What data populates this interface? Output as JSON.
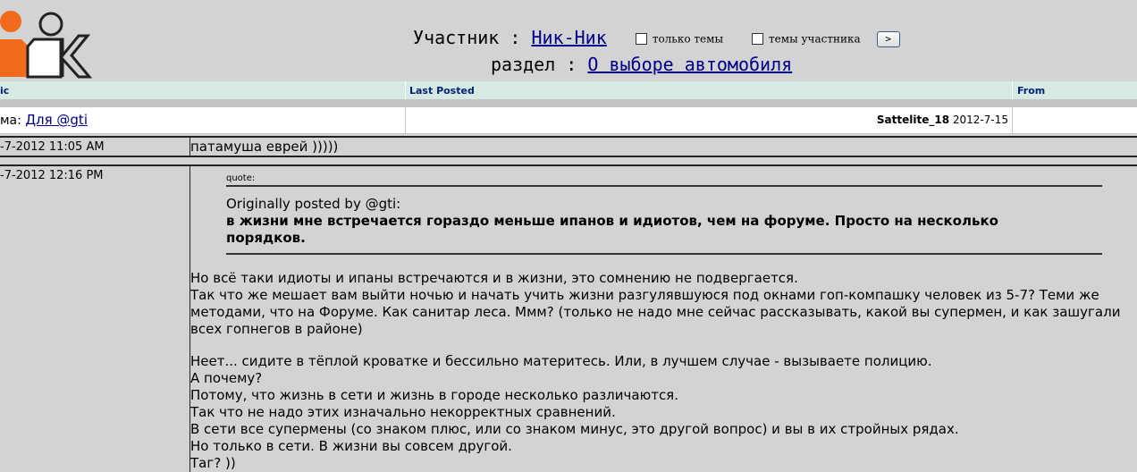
{
  "header": {
    "participant_label": "Участник",
    "colon": ":",
    "participant_name": "Ник-Ник",
    "option_topics_only": "только темы",
    "option_member_topics": "темы участника",
    "go_button": ">",
    "section_label": "раздел",
    "section_name": "О выборе автомобиля"
  },
  "columns": {
    "topic": "ic",
    "last_posted": "Last Posted",
    "from": "From"
  },
  "topic": {
    "prefix": "ма:",
    "title": "Для @gti",
    "author": "Sattelite_18",
    "date": "2012-7-15"
  },
  "posts": [
    {
      "date": "-7-2012 11:05 AM",
      "text": "патамуша еврей )))))"
    },
    {
      "date": "-7-2012 12:16 PM",
      "quote_label": "quote:",
      "quote_author": "Originally posted by @gti:",
      "quote_text": "в жизни мне встречается гораздо меньше ипанов и идиотов, чем на форуме. Просто на несколько порядков.",
      "paragraph1": [
        "Но всё таки идиоты и ипаны встречаются и в жизни, это сомнению не подвергается.",
        "Так что же мешает вам выйти ночью и начать учить жизни разгулявшуюся под окнами гоп-компашку человек из 5-7? Теми же методами, что на Форуме. Как санитар леса. Ммм? (только не надо мне сейчас рассказывать, какой вы супермен, и как зашугали всех гопнегов в районе)"
      ],
      "paragraph2": [
        "Неет... сидите в тёплой кроватке и бессильно материтесь. Или, в лучшем случае - вызываете полицию.",
        "А почему?",
        "Потому, что жизнь в сети и жизнь в городе несколько различаются.",
        "Так что не надо этих изначально некорректных сравнений.",
        "В сети все супермены (со знаком плюс, или со знаком минус, это другой вопрос) и вы в их стройных рядах.",
        "Но только в сети. В жизни вы совсем другой.",
        "Таг? ))"
      ]
    }
  ],
  "colors": {
    "page_bg": "#d3d3d3",
    "header_bar": "#d7e9e3",
    "link": "#00008b",
    "logo_orange": "#f26a1b"
  },
  "icons": {
    "logo": "nik-logo"
  }
}
